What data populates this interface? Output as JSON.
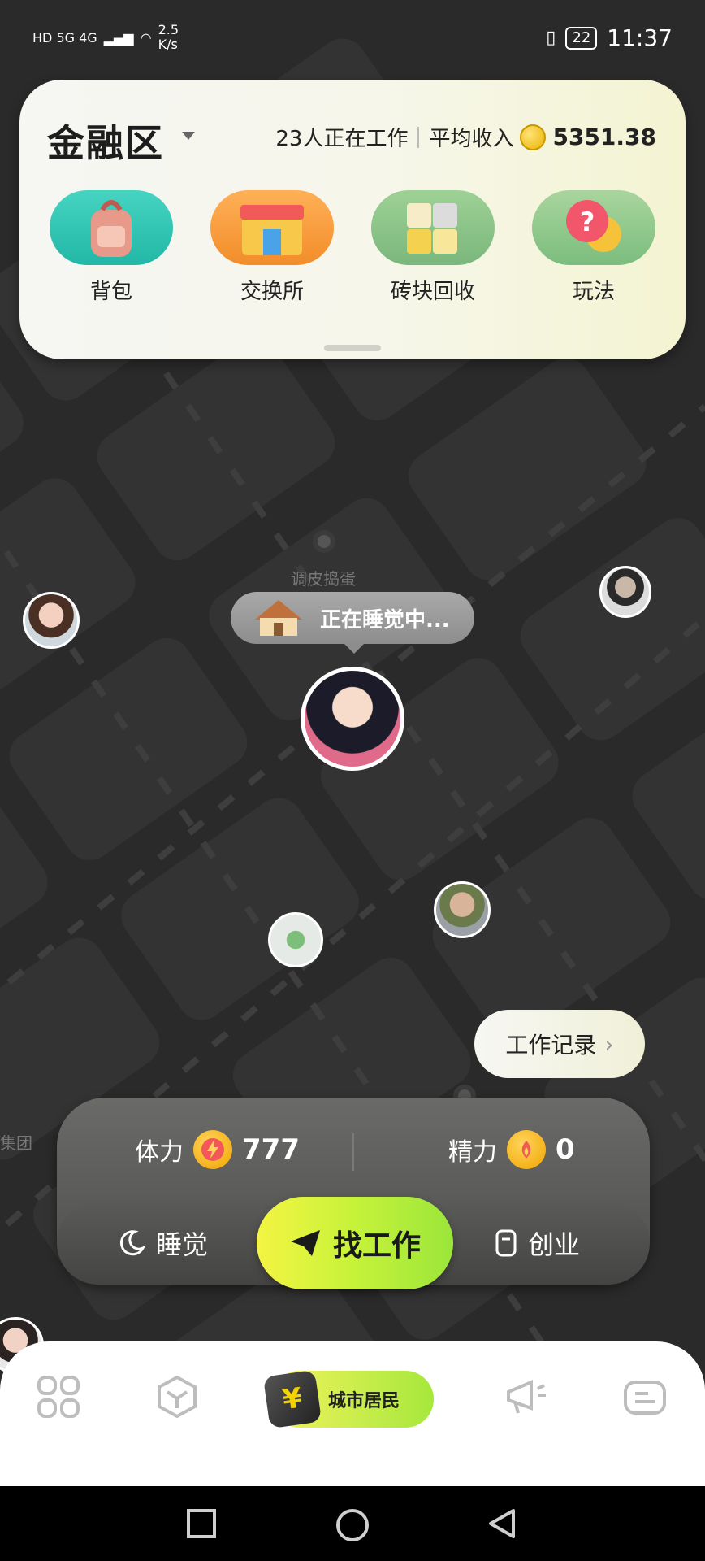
{
  "status_bar": {
    "network_left": "HD 5G 4G",
    "speed_value": "2.5",
    "speed_unit": "K/s",
    "battery": "22",
    "time": "11:37"
  },
  "top_card": {
    "district": "金融区",
    "working_count": "23人正在工作",
    "avg_income_label": "平均收入",
    "avg_income_value": "5351.38",
    "tools": [
      {
        "label": "背包",
        "icon": "backpack-icon"
      },
      {
        "label": "交换所",
        "icon": "shop-icon"
      },
      {
        "label": "砖块回收",
        "icon": "blocks-icon"
      },
      {
        "label": "玩法",
        "icon": "help-icon"
      }
    ]
  },
  "map": {
    "player_name": "调皮捣蛋",
    "status_bubble": "正在睡觉中...",
    "edge_label": "集团"
  },
  "work_record_button": "工作记录",
  "stats": {
    "stamina_label": "体力",
    "stamina_value": "777",
    "energy_label": "精力",
    "energy_value": "0"
  },
  "actions": {
    "sleep": "睡觉",
    "find_job": "找工作",
    "startup": "创业"
  },
  "nav": {
    "center_label": "城市居民",
    "center_badge": "¥"
  },
  "colors": {
    "accent_yellow": "#f4f542",
    "accent_green": "#9be63a",
    "map_bg": "#2a2a2a"
  }
}
